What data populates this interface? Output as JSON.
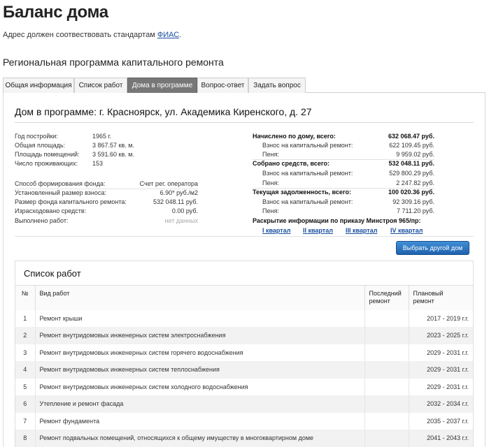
{
  "header": {
    "title": "Баланс дома",
    "note_prefix": "Адрес должен соотвествовать стандартам ",
    "note_link": "ФИАС",
    "note_suffix": ".",
    "section_title": "Региональная программа капитального ремонта"
  },
  "tabs": [
    {
      "label": "Общая информация",
      "active": false
    },
    {
      "label": "Список работ",
      "active": false
    },
    {
      "label": "Дома в программе",
      "active": true
    },
    {
      "label": "Вопрос-ответ",
      "active": false
    },
    {
      "label": "Задать вопрос",
      "active": false
    }
  ],
  "house": {
    "title": "Дом в программе: г. Красноярск, ул. Академика Киренского, д. 27"
  },
  "info_left": [
    {
      "label": "Год постройки:",
      "value": "1965 г."
    },
    {
      "label": "Общая площадь:",
      "value": "3 867.57 кв. м."
    },
    {
      "label": "Площадь помещений:",
      "value": "3 591.60 кв. м."
    },
    {
      "label": "Число проживающих:",
      "value": "153"
    }
  ],
  "fund_left": [
    {
      "label": "Способ формирования фонда:",
      "value": "Счет рег. оператора"
    },
    {
      "label": "Установленный размер взноса:",
      "value": "6.90* руб./м2"
    },
    {
      "label": "Размер фонда капитального ремонта:",
      "value": "532 048.11 руб."
    },
    {
      "label": "Израсходовано средств:",
      "value": "0.00 руб."
    },
    {
      "label": "Выполнено работ:",
      "value": "нет данных"
    }
  ],
  "finance_right": [
    {
      "label": "Начислено по дому, всего:",
      "value": "632 068.47 руб.",
      "bold": true
    },
    {
      "label": "Взнос на капитальный ремонт:",
      "value": "622 109.45 руб.",
      "bold": false
    },
    {
      "label": "Пеня:",
      "value": "9 959.02 руб.",
      "bold": false
    },
    {
      "label": "Собрано средств, всего:",
      "value": "532 048.11 руб.",
      "bold": true
    },
    {
      "label": "Взнос на капитальный ремонт:",
      "value": "529 800.29 руб.",
      "bold": false
    },
    {
      "label": "Пеня:",
      "value": "2 247.82 руб.",
      "bold": false
    },
    {
      "label": "Текущая задолженность, всего:",
      "value": "100 020.36 руб.",
      "bold": true
    },
    {
      "label": "Взнос на капитальный ремонт:",
      "value": "92 309.16 руб.",
      "bold": false
    },
    {
      "label": "Пеня:",
      "value": "7 711.20 руб.",
      "bold": false
    }
  ],
  "disclosure": {
    "title": "Раскрытие информации по приказу Минстроя 965/пр:",
    "links": [
      "I квартал",
      "II квартал",
      "III квартал",
      "IV квартал"
    ]
  },
  "choose_button": "Выбрать другой дом",
  "works": {
    "title": "Список работ",
    "headers": {
      "num": "№",
      "kind": "Вид работ",
      "last_line1": "Последний",
      "last_line2": "ремонт",
      "plan_line1": "Плановый",
      "plan_line2": "ремонт"
    },
    "rows": [
      {
        "num": "1",
        "kind": "Ремонт крыши",
        "last": "",
        "plan": "2017 - 2019 г.г."
      },
      {
        "num": "2",
        "kind": "Ремонт внутридомовых инженерных систем электроснабжения",
        "last": "",
        "plan": "2023 - 2025 г.г."
      },
      {
        "num": "3",
        "kind": "Ремонт внутридомовых инженерных систем горячего водоснабжения",
        "last": "",
        "plan": "2029 - 2031 г.г."
      },
      {
        "num": "4",
        "kind": "Ремонт внутридомовых инженерных систем теплоснабжения",
        "last": "",
        "plan": "2029 - 2031 г.г."
      },
      {
        "num": "5",
        "kind": "Ремонт внутридомовых инженерных систем холодного водоснабжения",
        "last": "",
        "plan": "2029 - 2031 г.г."
      },
      {
        "num": "6",
        "kind": "Утепление и ремонт фасада",
        "last": "",
        "plan": "2032 - 2034 г.г."
      },
      {
        "num": "7",
        "kind": "Ремонт фундамента",
        "last": "",
        "plan": "2035 - 2037 г.г."
      },
      {
        "num": "8",
        "kind": "Ремонт подвальных помещений, относящихся к общему имуществу в многоквартирном доме",
        "last": "",
        "plan": "2041 - 2043 г.г."
      }
    ]
  }
}
